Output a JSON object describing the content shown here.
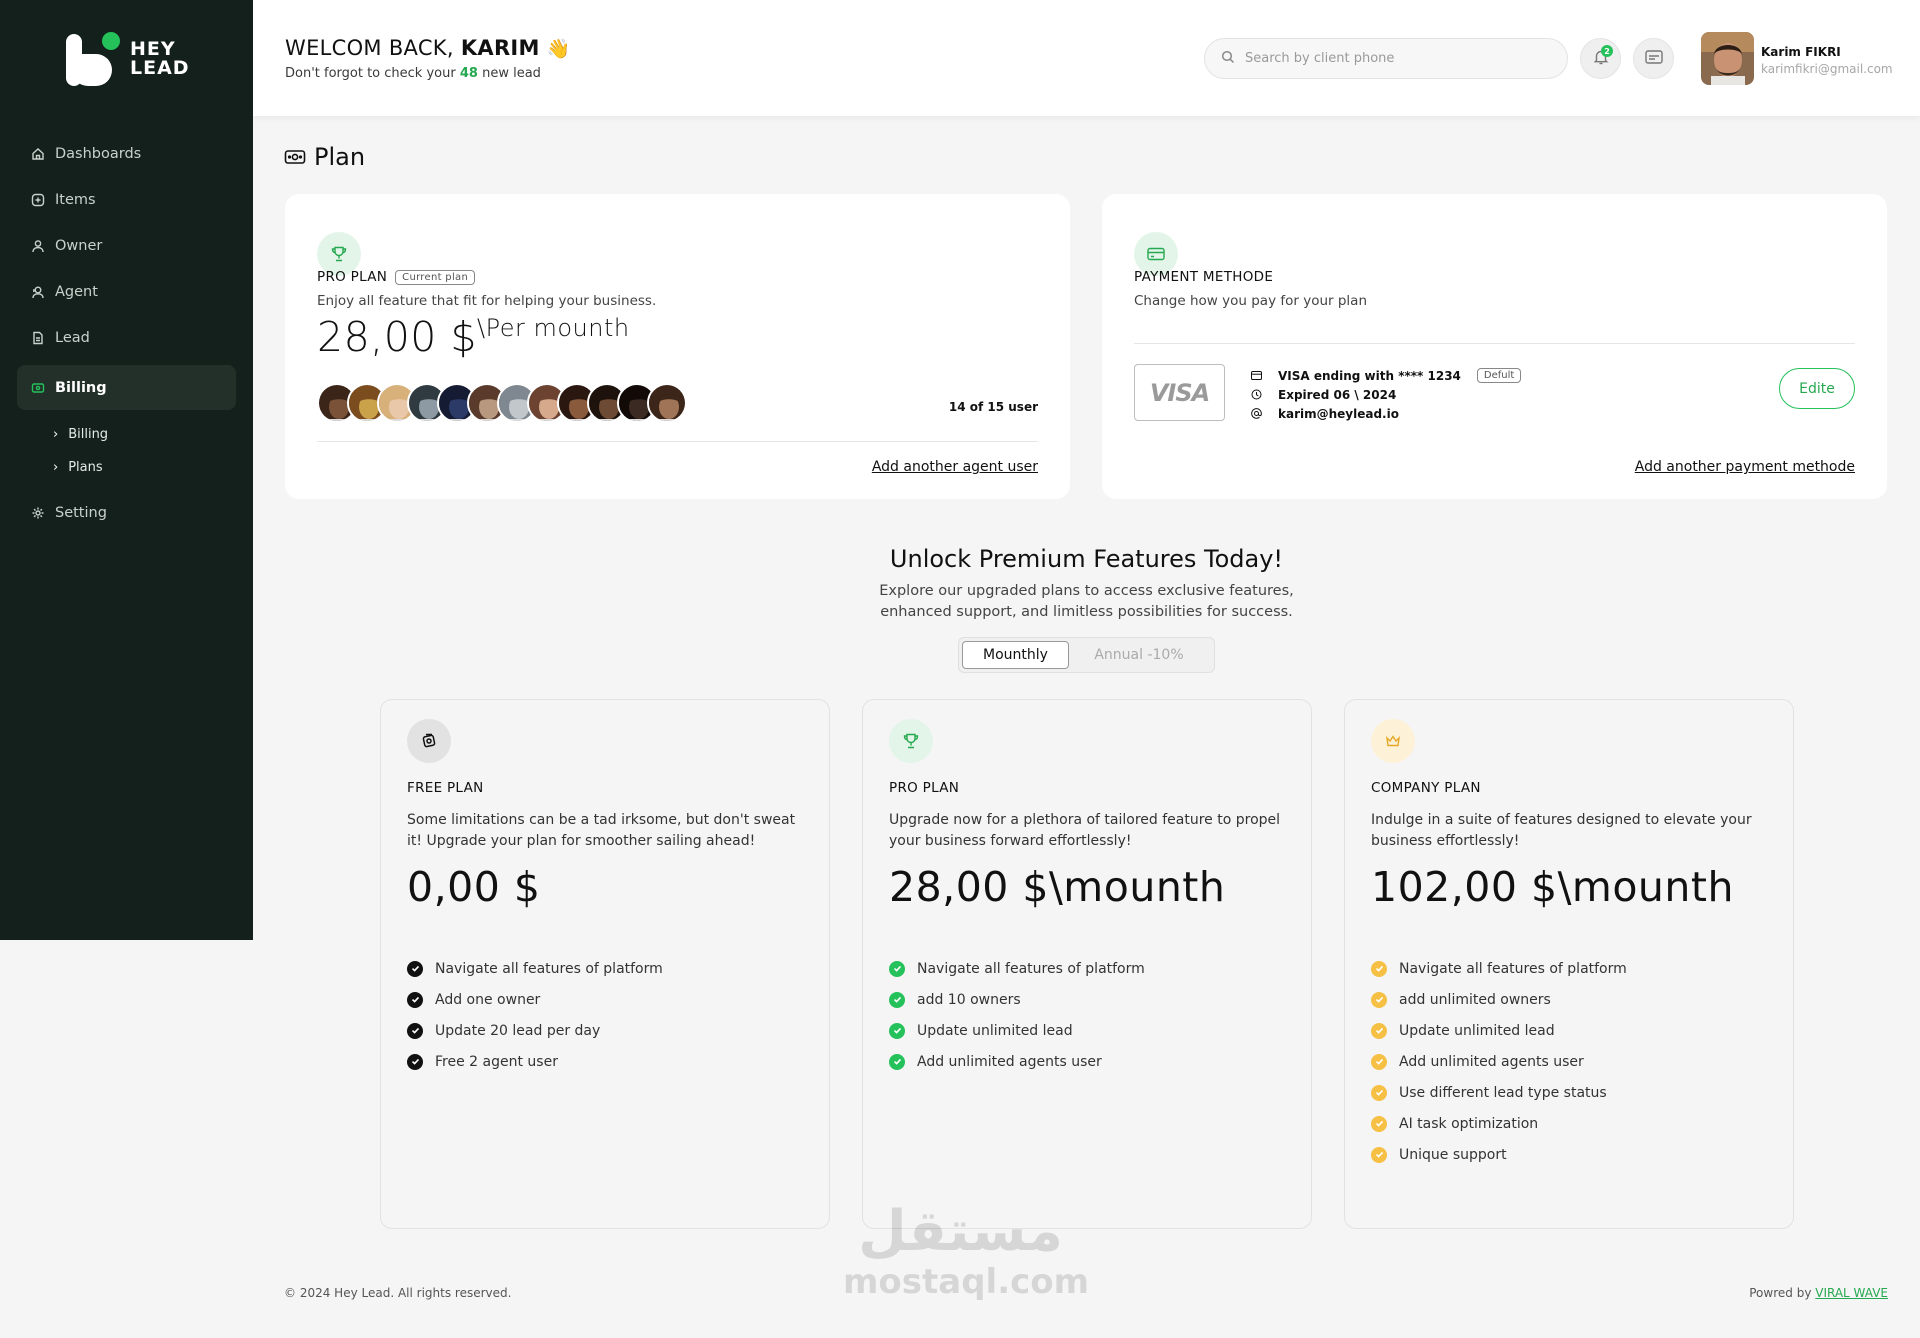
{
  "brand": {
    "line1": "HEY",
    "line2": "LEAD"
  },
  "sidebar": {
    "items": [
      {
        "label": "Dashboards",
        "icon": "home-icon"
      },
      {
        "label": "Items",
        "icon": "plus-square-icon"
      },
      {
        "label": "Owner",
        "icon": "user-icon"
      },
      {
        "label": "Agent",
        "icon": "agent-icon"
      },
      {
        "label": "Lead",
        "icon": "document-icon"
      },
      {
        "label": "Billing",
        "icon": "billing-icon",
        "active": true
      },
      {
        "label": "Setting",
        "icon": "gear-icon"
      }
    ],
    "sub_items": [
      {
        "label": "Billing"
      },
      {
        "label": "Plans"
      }
    ]
  },
  "header": {
    "welcome_prefix": "WELCOM BACK,",
    "welcome_name": "KARIM",
    "wave": "👋",
    "sub_prefix": "Don't forgot to check your",
    "sub_count": "48",
    "sub_suffix": "new lead",
    "search_placeholder": "Search by client phone",
    "notification_count": "2",
    "user_name": "Karim FIKRI",
    "user_email": "karimfikri@gmail.com"
  },
  "page": {
    "title": "Plan"
  },
  "current_plan": {
    "title": "PRO PLAN",
    "tag": "Current plan",
    "desc": "Enjoy all feature that fit for helping your business.",
    "price": "28,00 $",
    "price_per": "\\Per mounth",
    "user_count": "14 of 15 user",
    "link": "Add another agent user"
  },
  "payment": {
    "title": "PAYMENT METHODE",
    "desc": "Change how you pay for your plan",
    "card_brand": "VISA",
    "card_number": "VISA ending with **** 1234",
    "card_tag": "Defult",
    "expiry": "Expired 06 \\ 2024",
    "email": "karim@heylead.io",
    "edit": "Edite",
    "link": "Add another payment methode"
  },
  "unlock": {
    "title": "Unlock Premium Features Today!",
    "sub1": "Explore our upgraded plans to access exclusive features,",
    "sub2": "enhanced support, and limitless possibilities for success.",
    "toggle_monthly": "Mounthly",
    "toggle_annual": "Annual -10%"
  },
  "plans": [
    {
      "title": "FREE PLAN",
      "desc": "Some limitations can be a tad irksome, but don't sweat it! Upgrade your plan for smoother sailing ahead!",
      "price": "0,00 $",
      "accent": "#111111",
      "icon_bg": "#e2e2e2",
      "features": [
        "Navigate all features of platform",
        "Add one owner",
        "Update 20 lead per day",
        "Free 2 agent user"
      ]
    },
    {
      "title": "PRO PLAN",
      "desc": "Upgrade now for a plethora of tailored feature to propel your business forward effortlessly!",
      "price": "28,00 $\\mounth",
      "accent": "#25c15b",
      "icon_bg": "#e3f5e8",
      "features": [
        "Navigate all features of platform",
        "add 10 owners",
        "Update unlimited lead",
        "Add unlimited agents user"
      ]
    },
    {
      "title": "COMPANY  PLAN",
      "desc": "Indulge in a suite of features designed to elevate your business effortlessly!",
      "price": "102,00 $\\mounth",
      "accent": "#f5c044",
      "icon_bg": "#fdf1d8",
      "features": [
        "Navigate all features of platform",
        "add unlimited owners",
        "Update unlimited lead",
        "Add unlimited agents user",
        "Use different lead type status",
        "AI task optimization",
        "Unique support"
      ]
    }
  ],
  "footer": {
    "copyright": "© 2024 Hey Lead. All rights reserved.",
    "powered_prefix": "Powred by",
    "powered_link": "VIRAL WAVE"
  },
  "watermark": {
    "arabic": "مستقل",
    "latin": "mostaql.com"
  },
  "colors": {
    "sidebar_bg": "#13201b",
    "accent_green": "#25c15b",
    "accent_yellow": "#f5c044"
  }
}
